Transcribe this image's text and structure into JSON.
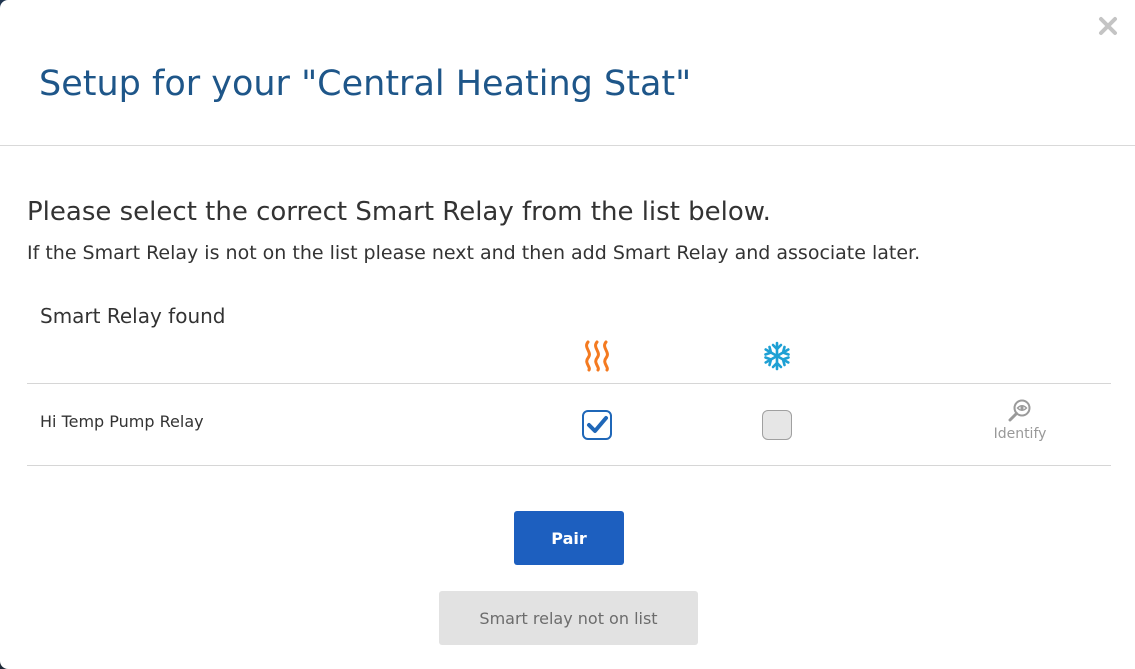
{
  "modal": {
    "title": "Setup for your \"Central Heating Stat\"",
    "close_symbol": "✕"
  },
  "content": {
    "instruction": "Please select the correct Smart Relay from the list below.",
    "subinstruction": "If the Smart Relay is not on the list please next and then add Smart Relay and associate later.",
    "section_label": "Smart Relay found"
  },
  "columns": {
    "heat_icon": "heat-waves-icon",
    "cool_icon": "snowflake-icon",
    "heat_color": "#f47a20",
    "cool_color": "#1ea0d4"
  },
  "relays": [
    {
      "name": "Hi Temp Pump Relay",
      "heat_checked": true,
      "cool_checked": false,
      "identify_label": "Identify"
    }
  ],
  "actions": {
    "pair_label": "Pair",
    "not_on_list_label": "Smart relay not on list",
    "primary_color": "#1d5fbf"
  }
}
